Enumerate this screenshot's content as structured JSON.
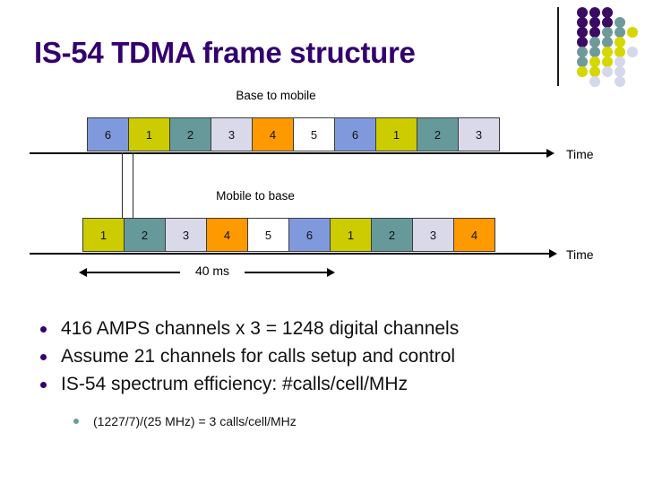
{
  "slide": {
    "title": "IS-54 TDMA frame structure",
    "title_color": "#33006f",
    "background": "#ffffff"
  },
  "diagram": {
    "base_caption": "Base to mobile",
    "mobile_caption": "Mobile to base",
    "time_label_base": "Time",
    "time_label_mobile": "Time",
    "duration_label": "40 ms",
    "slot_colors": {
      "1": "#cccc00",
      "2": "#669999",
      "3": "#d9d9ea",
      "4": "#ff9900",
      "5": "#ffffff",
      "6": "#8099dd"
    },
    "base_to_mobile_slots": [
      "6",
      "1",
      "2",
      "3",
      "4",
      "5",
      "6",
      "1",
      "2",
      "3"
    ],
    "mobile_to_base_slots": [
      "1",
      "2",
      "3",
      "4",
      "5",
      "6",
      "1",
      "2",
      "3",
      "4"
    ]
  },
  "bullets": [
    {
      "level": 1,
      "text": "416 AMPS channels x 3 = 1248 digital channels"
    },
    {
      "level": 1,
      "text": "Assume 21 channels for calls setup and control"
    },
    {
      "level": 1,
      "text": "IS-54 spectrum efficiency: #calls/cell/MHz"
    },
    {
      "level": 2,
      "text": "(1227/7)/(25 MHz) = 3 calls/cell/MHz"
    }
  ],
  "logo": {
    "rule_color": "#1a1a1a",
    "palette": {
      "p": "#3b0a62",
      "t": "#6f9a9a",
      "y": "#d6d600",
      "l": "#d5d8ea"
    },
    "grid": [
      [
        "p",
        "p",
        "p",
        "",
        ""
      ],
      [
        "p",
        "p",
        "p",
        "t",
        ""
      ],
      [
        "p",
        "p",
        "t",
        "t",
        "y"
      ],
      [
        "p",
        "t",
        "t",
        "y",
        ""
      ],
      [
        "t",
        "t",
        "y",
        "y",
        "l"
      ],
      [
        "t",
        "y",
        "y",
        "l",
        ""
      ],
      [
        "y",
        "y",
        "l",
        "l",
        ""
      ],
      [
        "",
        "l",
        "",
        "l",
        ""
      ]
    ]
  }
}
